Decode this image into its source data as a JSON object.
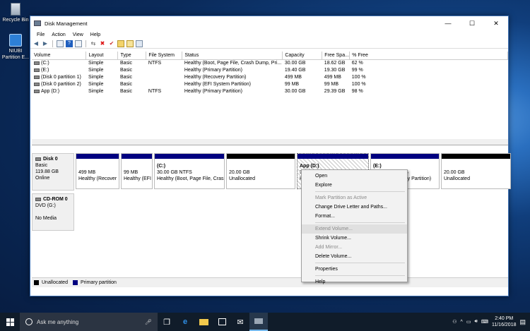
{
  "desktop": {
    "icons": [
      {
        "label": "Recycle Bin",
        "icon": "recycle-bin-icon"
      },
      {
        "label": "NIUBI Partition E...",
        "icon": "niubi-app-icon"
      }
    ]
  },
  "window": {
    "title": "Disk Management",
    "controls": {
      "minimize": "—",
      "maximize": "☐",
      "close": "✕"
    }
  },
  "menu": [
    "File",
    "Action",
    "View",
    "Help"
  ],
  "volume_table": {
    "headers": [
      "Volume",
      "Layout",
      "Type",
      "File System",
      "Status",
      "Capacity",
      "Free Spa...",
      "% Free"
    ],
    "rows": [
      [
        "(C:)",
        "Simple",
        "Basic",
        "NTFS",
        "Healthy (Boot, Page File, Crash Dump, Pri...",
        "30.00 GB",
        "18.62 GB",
        "62 %"
      ],
      [
        "(E:)",
        "Simple",
        "Basic",
        "",
        "Healthy (Primary Partition)",
        "19.40 GB",
        "19.30 GB",
        "99 %"
      ],
      [
        "(Disk 0 partition 1)",
        "Simple",
        "Basic",
        "",
        "Healthy (Recovery Partition)",
        "499 MB",
        "499 MB",
        "100 %"
      ],
      [
        "(Disk 0 partition 2)",
        "Simple",
        "Basic",
        "",
        "Healthy (EFI System Partition)",
        "99 MB",
        "99 MB",
        "100 %"
      ],
      [
        "App (D:)",
        "Simple",
        "Basic",
        "NTFS",
        "Healthy (Primary Partition)",
        "30.00 GB",
        "29.39 GB",
        "98 %"
      ]
    ]
  },
  "disk0": {
    "name": "Disk 0",
    "type": "Basic",
    "size": "119.88 GB",
    "state": "Online",
    "partitions": [
      {
        "title": "",
        "size": "499 MB",
        "status": "Healthy (Recover",
        "kind": "primary"
      },
      {
        "title": "",
        "size": "99 MB",
        "status": "Healthy (EFI",
        "kind": "primary"
      },
      {
        "title": "(C:)",
        "size": "30.00 GB NTFS",
        "status": "Healthy (Boot, Page File, Crash",
        "kind": "primary"
      },
      {
        "title": "",
        "size": "20.00 GB",
        "status": "Unallocated",
        "kind": "unallocated"
      },
      {
        "title": "App  (D:)",
        "size": "30.00 GB NTFS",
        "status": "Healthy (Primary Partition)",
        "kind": "primary",
        "selected": true
      },
      {
        "title": "(E:)",
        "size": "19.40 GB NTFS",
        "status": "Healthy (Primary Partition)",
        "kind": "primary"
      },
      {
        "title": "",
        "size": "20.00 GB",
        "status": "Unallocated",
        "kind": "unallocated"
      }
    ]
  },
  "cdrom": {
    "name": "CD-ROM 0",
    "drive": "DVD (G:)",
    "media": "No Media"
  },
  "legend": {
    "unallocated": "Unallocated",
    "primary": "Primary partition",
    "unallocated_color": "#000000",
    "primary_color": "#000080"
  },
  "context_menu": {
    "items": [
      {
        "label": "Open",
        "disabled": false
      },
      {
        "label": "Explore",
        "disabled": false
      },
      {
        "sep": true
      },
      {
        "label": "Mark Partition as Active",
        "disabled": true
      },
      {
        "label": "Change Drive Letter and Paths...",
        "disabled": false
      },
      {
        "label": "Format...",
        "disabled": false
      },
      {
        "sep": true
      },
      {
        "label": "Extend Volume...",
        "disabled": true,
        "highlight": true
      },
      {
        "label": "Shrink Volume...",
        "disabled": false
      },
      {
        "label": "Add Mirror...",
        "disabled": true
      },
      {
        "label": "Delete Volume...",
        "disabled": false
      },
      {
        "sep": true
      },
      {
        "label": "Properties",
        "disabled": false
      },
      {
        "sep": true
      },
      {
        "label": "Help",
        "disabled": false
      }
    ]
  },
  "taskbar": {
    "search_placeholder": "Ask me anything",
    "time": "2:40 PM",
    "date": "11/16/2018"
  }
}
